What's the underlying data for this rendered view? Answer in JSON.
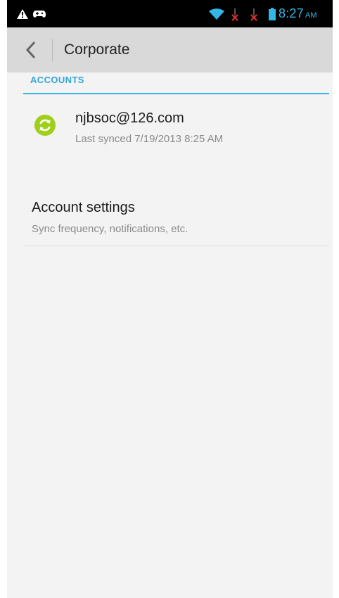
{
  "status_bar": {
    "time": "8:27",
    "ampm": "AM",
    "icons": [
      "warning-icon",
      "gamepad-icon",
      "wifi-icon",
      "sim-no-signal-icon",
      "sim-no-signal-icon",
      "battery-icon"
    ]
  },
  "action_bar": {
    "title": "Corporate",
    "back_icon": "chevron-left-icon"
  },
  "accounts": {
    "header": "ACCOUNTS",
    "items": [
      {
        "email": "njbsoc@126.com",
        "last_synced": "Last synced 7/19/2013 8:25 AM",
        "icon": "sync-icon"
      }
    ]
  },
  "settings": {
    "title": "Account settings",
    "summary": "Sync frequency, notifications, etc."
  },
  "colors": {
    "accent": "#33b5e5",
    "sync_green": "#9fcf1b",
    "action_bar": "#d9d9d9",
    "background": "#f3f3f3"
  }
}
